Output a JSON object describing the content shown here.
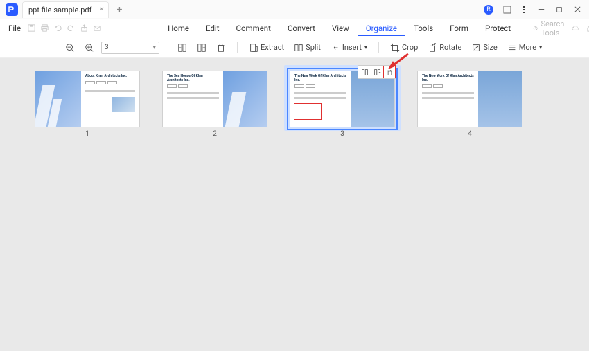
{
  "titlebar": {
    "tab_label": "ppt file-sample.pdf"
  },
  "menubar": {
    "file": "File",
    "items": [
      "Home",
      "Edit",
      "Comment",
      "Convert",
      "View",
      "Organize",
      "Tools",
      "Form",
      "Protect"
    ],
    "active_index": 5,
    "search_placeholder": "Search Tools"
  },
  "toolbar": {
    "page_value": "3",
    "extract": "Extract",
    "split": "Split",
    "insert": "Insert",
    "crop": "Crop",
    "rotate": "Rotate",
    "size": "Size",
    "more": "More"
  },
  "pages": [
    {
      "num": "1",
      "title": "About Khan Architects Inc."
    },
    {
      "num": "2",
      "title": "The Sea House Of Klan Architects Inc."
    },
    {
      "num": "3",
      "title": "The New Work Of Klan Architects Inc."
    },
    {
      "num": "4",
      "title": "The New Work Of Klan Architects Inc."
    }
  ],
  "selected_page": "3",
  "icons": {
    "user_badge": "R"
  }
}
